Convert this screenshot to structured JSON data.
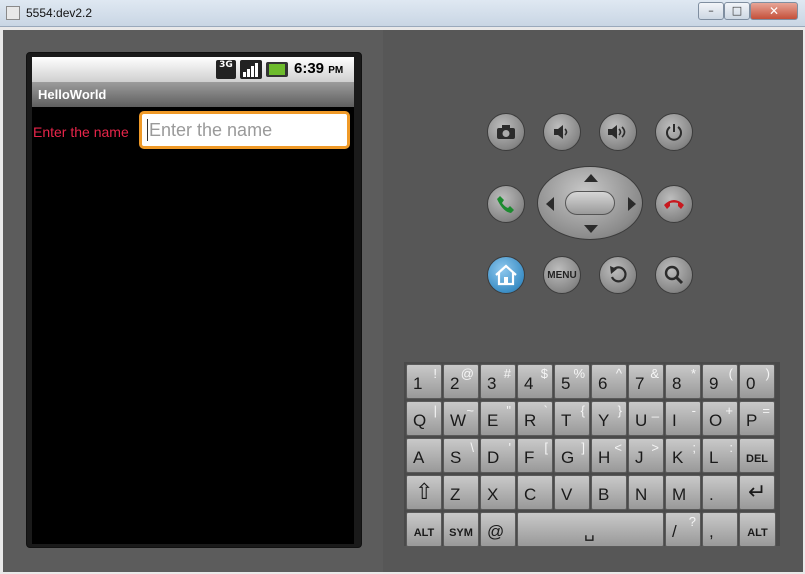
{
  "window": {
    "title": "5554:dev2.2",
    "min_label": "–",
    "max_label": "□",
    "close_label": "✕"
  },
  "status_bar": {
    "network": "3G",
    "time": "6:39",
    "ampm": "PM"
  },
  "app": {
    "title": "HelloWorld",
    "label_text": "Enter the name",
    "input_placeholder": "Enter the name"
  },
  "controls": {
    "menu_label": "MENU"
  },
  "keyboard": {
    "rows": [
      [
        {
          "m": "1",
          "a": "!"
        },
        {
          "m": "2",
          "a": "@"
        },
        {
          "m": "3",
          "a": "#"
        },
        {
          "m": "4",
          "a": "$"
        },
        {
          "m": "5",
          "a": "%"
        },
        {
          "m": "6",
          "a": "^"
        },
        {
          "m": "7",
          "a": "&"
        },
        {
          "m": "8",
          "a": "*"
        },
        {
          "m": "9",
          "a": "("
        },
        {
          "m": "0",
          "a": ")"
        }
      ],
      [
        {
          "m": "Q",
          "a": "|"
        },
        {
          "m": "W",
          "a": "~"
        },
        {
          "m": "E",
          "a": "\""
        },
        {
          "m": "R",
          "a": "`"
        },
        {
          "m": "T",
          "a": "{"
        },
        {
          "m": "Y",
          "a": "}"
        },
        {
          "m": "U",
          "a": "_"
        },
        {
          "m": "I",
          "a": "-"
        },
        {
          "m": "O",
          "a": "+"
        },
        {
          "m": "P",
          "a": "="
        }
      ],
      [
        {
          "m": "A",
          "a": ""
        },
        {
          "m": "S",
          "a": "\\"
        },
        {
          "m": "D",
          "a": "'"
        },
        {
          "m": "F",
          "a": "["
        },
        {
          "m": "G",
          "a": "]"
        },
        {
          "m": "H",
          "a": "<"
        },
        {
          "m": "J",
          "a": ">"
        },
        {
          "m": "K",
          "a": ";"
        },
        {
          "m": "L",
          "a": ":"
        },
        {
          "m": "DEL",
          "a": ""
        }
      ],
      [
        {
          "m": "⇧",
          "a": ""
        },
        {
          "m": "Z",
          "a": ""
        },
        {
          "m": "X",
          "a": ""
        },
        {
          "m": "C",
          "a": ""
        },
        {
          "m": "V",
          "a": ""
        },
        {
          "m": "B",
          "a": ""
        },
        {
          "m": "N",
          "a": ""
        },
        {
          "m": "M",
          "a": ""
        },
        {
          "m": ".",
          "a": ""
        },
        {
          "m": "↵",
          "a": ""
        }
      ]
    ],
    "bottom_row": {
      "alt_left": "ALT",
      "sym": "SYM",
      "at": "@",
      "space": "␣",
      "slash": "/",
      "slash_alt": "?",
      "comma": ",",
      "alt_right": "ALT"
    }
  }
}
